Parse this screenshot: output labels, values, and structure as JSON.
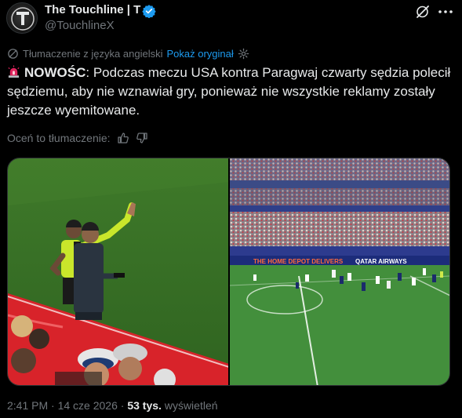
{
  "author": {
    "name": "The Touchline | T",
    "handle": "@TouchlineX"
  },
  "translation": {
    "label": "Tłumaczenie z języka angielski",
    "show_original": "Pokaż oryginał"
  },
  "tweet": {
    "headline": "NOWOŚC",
    "body": ": Podczas meczu USA kontra Paragwaj czwarty sędzia polecił sędziemu, aby nie wznawiał gry, ponieważ nie wszystkie reklamy zostały jeszcze wyemitowane."
  },
  "rate_translation": {
    "label": "Oceń to tłumaczenie:"
  },
  "media": {
    "left_image": "fourth-official-raising-hand-photo",
    "right_image": "stadium-match-wide-shot-photo",
    "board_text": "THE HOME DEPOT DELIVERS",
    "sponsor_text": "QATAR AIRWAYS"
  },
  "meta": {
    "time": "2:41 PM",
    "date": "14 cze 2026",
    "separator": "·",
    "views_count": "53 tys.",
    "views_label": "wyświetleń"
  },
  "colors": {
    "background": "#000000",
    "text": "#e7e9ea",
    "secondary": "#71767b",
    "accent": "#1d9bf0"
  }
}
